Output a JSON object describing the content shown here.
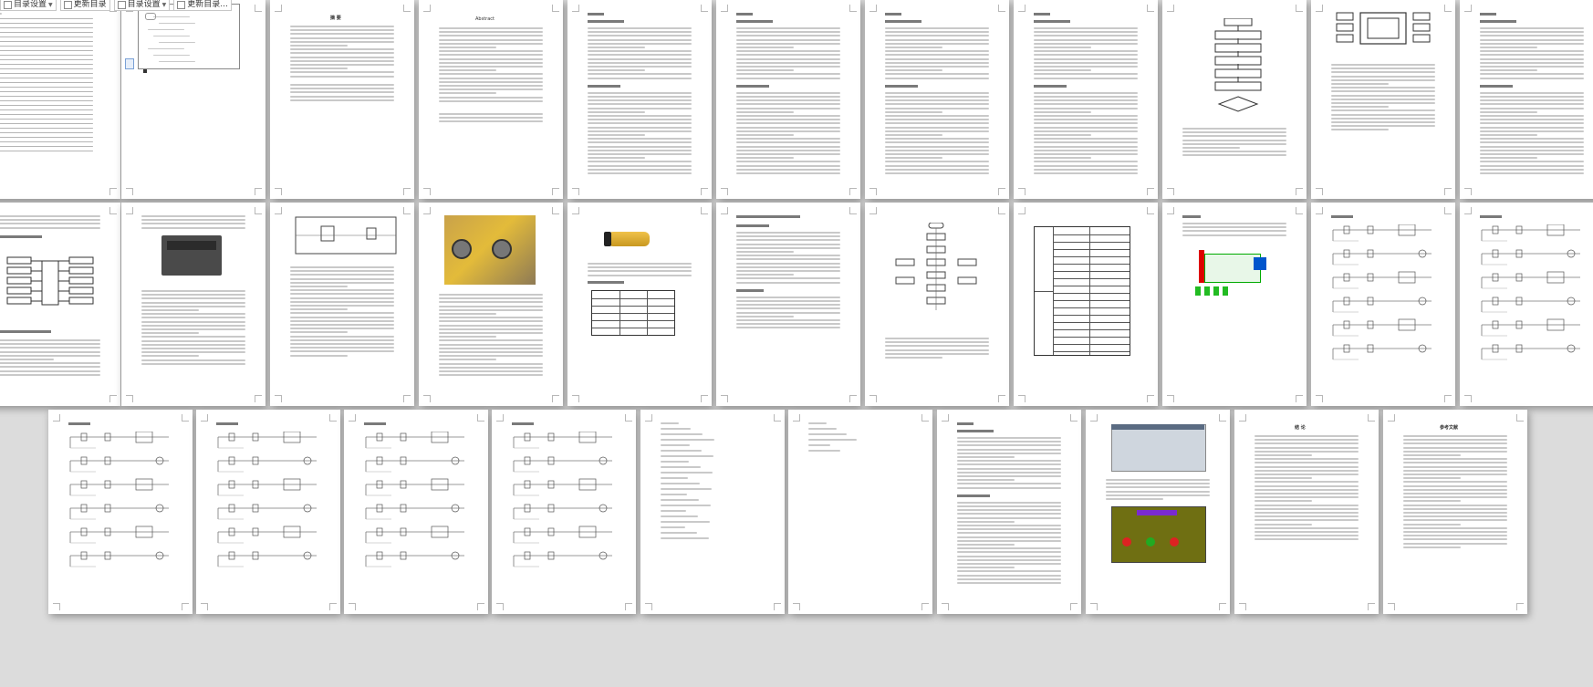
{
  "toolbar": {
    "buttons": [
      {
        "label": "目录设置",
        "has_dropdown": true,
        "icon": "toc-icon"
      },
      {
        "label": "更新目录",
        "has_dropdown": false,
        "icon": "refresh-icon"
      },
      {
        "label": "目录设置",
        "has_dropdown": true,
        "icon": "toc-icon"
      },
      {
        "label": "更新目录...",
        "has_dropdown": false,
        "icon": "refresh-icon"
      }
    ]
  },
  "pages": {
    "abstract_cn_title": "摘 要",
    "abstract_en_title": "Abstract",
    "conclusion_title": "结 论",
    "references_title": "参考文献"
  }
}
